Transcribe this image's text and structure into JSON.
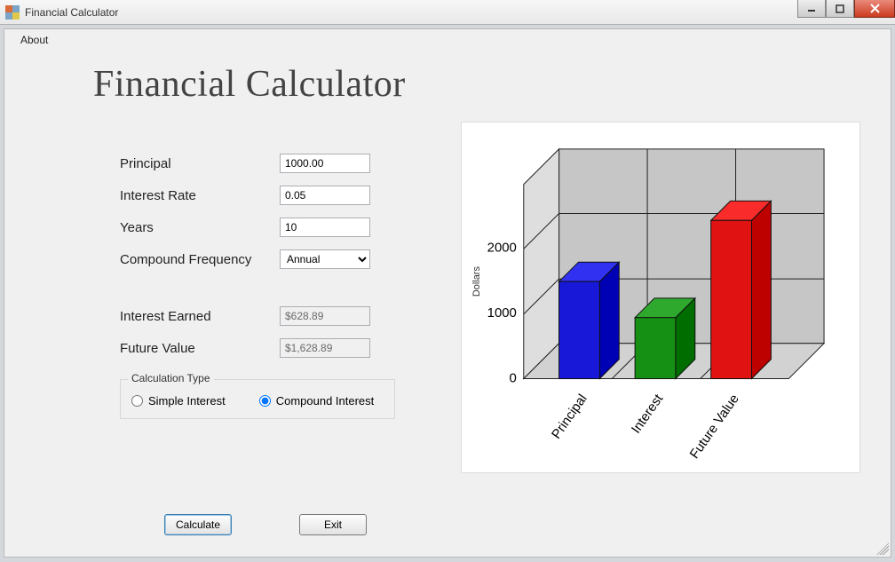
{
  "window": {
    "title": "Financial Calculator"
  },
  "menubar": {
    "about": "About"
  },
  "heading": "Financial Calculator",
  "form": {
    "labels": {
      "principal": "Principal",
      "rate": "Interest Rate",
      "years": "Years",
      "compfreq": "Compound Frequency",
      "interest_earned": "Interest Earned",
      "future_value": "Future Value"
    },
    "values": {
      "principal": "1000.00",
      "rate": "0.05",
      "years": "10",
      "compfreq": "Annual",
      "interest_earned": "$628.89",
      "future_value": "$1,628.89"
    }
  },
  "calc_type": {
    "legend": "Calculation Type",
    "simple": "Simple Interest",
    "compound": "Compound Interest",
    "selected": "compound"
  },
  "buttons": {
    "calculate": "Calculate",
    "exit": "Exit"
  },
  "chart_data": {
    "type": "bar",
    "categories": [
      "Principal",
      "Interest",
      "Future Value"
    ],
    "values": [
      1000,
      628.89,
      1628.89
    ],
    "ylabel": "Dollars",
    "ylim": [
      0,
      2000
    ],
    "yticks": [
      0,
      1000,
      2000
    ],
    "colors": [
      "#1818d8",
      "#159015",
      "#e01212"
    ]
  }
}
